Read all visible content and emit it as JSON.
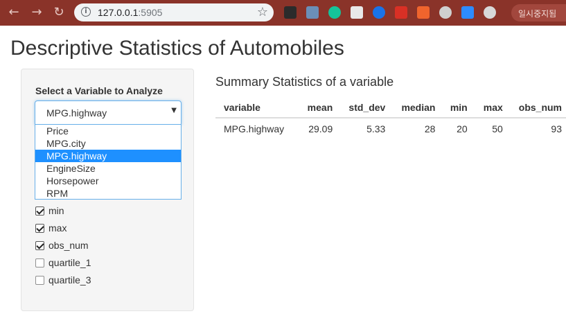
{
  "browser": {
    "url_host": "127.0.0.1",
    "url_port": ":5905",
    "pause_label": "일시중지됨",
    "extensions": [
      {
        "name": "ext-a-icon",
        "color": "#2b2b2b"
      },
      {
        "name": "ext-chart-icon",
        "color": "#6b8fb8"
      },
      {
        "name": "grammarly-icon",
        "color": "#15c39a"
      },
      {
        "name": "ext-card-icon",
        "color": "#e8e8e8"
      },
      {
        "name": "ext-ring-icon",
        "color": "#1a73e8"
      },
      {
        "name": "pdf-icon",
        "color": "#d93025"
      },
      {
        "name": "ext-ex-icon",
        "color": "#f0642d"
      },
      {
        "name": "ext-circle-icon",
        "color": "#cfcfcf"
      },
      {
        "name": "zoom-icon",
        "color": "#2d8cff"
      },
      {
        "name": "ext-globe-icon",
        "color": "#d8d8d8"
      }
    ]
  },
  "page": {
    "title": "Descriptive Statistics of Automobiles"
  },
  "sidebar": {
    "select_label": "Select a Variable to Analyze",
    "selected_value": "MPG.highway",
    "options": [
      "Price",
      "MPG.city",
      "MPG.highway",
      "EngineSize",
      "Horsepower",
      "RPM"
    ],
    "selected_index": 2,
    "checkboxes": [
      {
        "label": "min",
        "checked": true
      },
      {
        "label": "max",
        "checked": true
      },
      {
        "label": "obs_num",
        "checked": true
      },
      {
        "label": "quartile_1",
        "checked": false
      },
      {
        "label": "quartile_3",
        "checked": false
      }
    ]
  },
  "main": {
    "summary_title": "Summary Statistics of a variable",
    "table": {
      "headers": [
        "variable",
        "mean",
        "std_dev",
        "median",
        "min",
        "max",
        "obs_num"
      ],
      "rows": [
        [
          "MPG.highway",
          "29.09",
          "5.33",
          "28",
          "20",
          "50",
          "93"
        ]
      ]
    }
  },
  "colors": {
    "chrome": "#8a3329",
    "selected_option": "#1e90ff",
    "focus_border": "#66afe9"
  }
}
